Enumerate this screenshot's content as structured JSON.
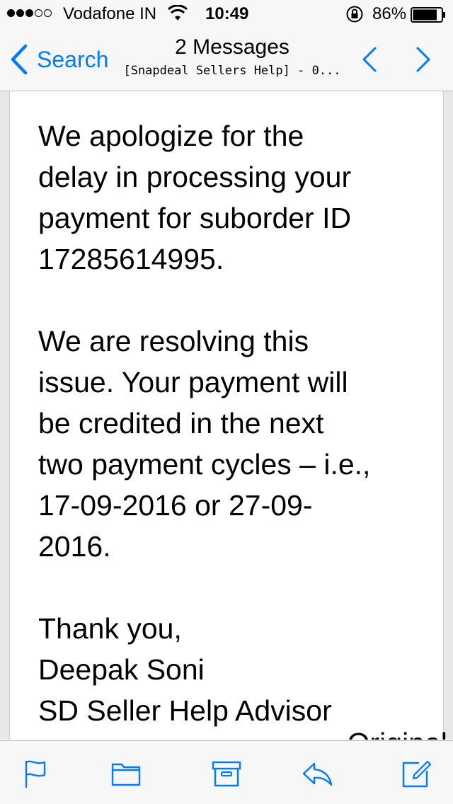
{
  "status_bar": {
    "carrier": "Vodafone IN",
    "time": "10:49",
    "battery_percent": "86%",
    "battery_level": 0.86,
    "signal_bars_filled": 3,
    "signal_bars_total": 5
  },
  "nav": {
    "back_label": "Search",
    "title": "2 Messages",
    "subtitle": "[Snapdeal Sellers Help] - 0..."
  },
  "message": {
    "paragraph_1": "We apologize for the\ndelay in processing your\npayment for suborder ID\n17285614995.",
    "paragraph_2": "We are resolving this\nissue. Your payment will\nbe credited in the next\ntwo payment cycles – i.e.,\n17-09-2016 or 27-09-\n2016.",
    "closing": "Thank you,",
    "signer_name": "Deepak Soni",
    "signer_title": "SD Seller Help Advisor",
    "cut_off_text": "-------- Original"
  },
  "toolbar": {
    "icons": [
      "flag-icon",
      "folder-icon",
      "archive-icon",
      "reply-icon",
      "compose-icon"
    ]
  },
  "colors": {
    "accent": "#007aff",
    "bar_background": "#f7f7f7",
    "text": "#000000"
  }
}
